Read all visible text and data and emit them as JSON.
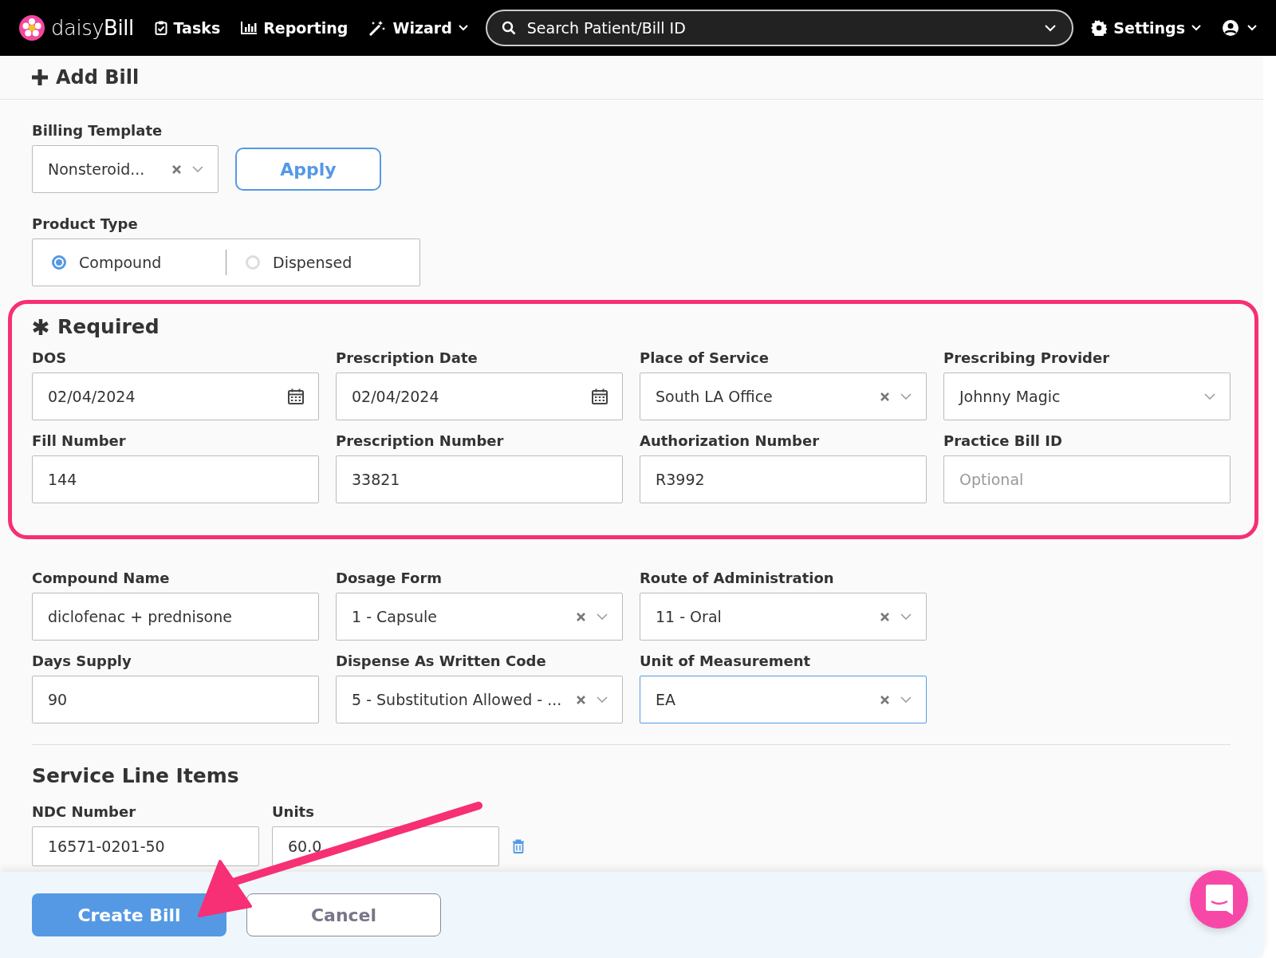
{
  "nav": {
    "logo": "daisy**Bill**",
    "items": [
      {
        "label": "Tasks",
        "dropdown": false
      },
      {
        "label": "Reporting",
        "dropdown": false
      },
      {
        "label": "Wizard",
        "dropdown": true
      }
    ],
    "search": {
      "placeholder": "Search Patient/Bill ID"
    },
    "settings": {
      "label": "Settings"
    }
  },
  "page_title": "Add Bill",
  "billing_template": {
    "label": "Billing Template",
    "value": "Nonsteroid...",
    "apply": "Apply"
  },
  "product_type": {
    "label": "Product Type",
    "options": [
      {
        "label": "Compound",
        "selected": true
      },
      {
        "label": "Dispensed",
        "selected": false
      }
    ]
  },
  "required": {
    "title": "Required",
    "fields": [
      {
        "label": "DOS",
        "kind": "date",
        "value": "02/04/2024",
        "focused": false
      },
      {
        "label": "Prescription Date",
        "kind": "date",
        "value": "02/04/2024",
        "focused": false
      },
      {
        "label": "Place of Service",
        "kind": "select",
        "value": "South LA Office",
        "clearable": true,
        "focused": false
      },
      {
        "label": "Prescribing Provider",
        "kind": "select",
        "value": "Johnny Magic",
        "clearable": false,
        "focused": false
      },
      {
        "label": "Fill Number",
        "kind": "text",
        "value": "144",
        "focused": false
      },
      {
        "label": "Prescription Number",
        "kind": "text",
        "value": "33821",
        "focused": false
      },
      {
        "label": "Authorization Number",
        "kind": "text",
        "value": "R3992",
        "focused": false
      },
      {
        "label": "Practice Bill ID",
        "kind": "text",
        "placeholder": "Optional",
        "focused": false
      }
    ]
  },
  "compound_fields": [
    {
      "label": "Compound Name",
      "kind": "text",
      "value": "diclofenac + prednisone",
      "focused": false
    },
    {
      "label": "Dosage Form",
      "kind": "select",
      "value": "1 - Capsule",
      "clearable": true,
      "focused": false
    },
    {
      "label": "Route of Administration",
      "kind": "select",
      "value": "11 - Oral",
      "clearable": true,
      "focused": false
    },
    {
      "label": "Days Supply",
      "kind": "text",
      "value": "90",
      "focused": false
    },
    {
      "label": "Dispense As Written Code",
      "kind": "select",
      "value": "5 - Substitution Allowed - ...",
      "clearable": true,
      "focused": false
    },
    {
      "label": "Unit of Measurement",
      "kind": "select",
      "value": "EA",
      "clearable": true,
      "focused": true
    }
  ],
  "service_line_items": {
    "title": "Service Line Items",
    "columns": [
      "NDC Number",
      "Units"
    ],
    "rows": [
      {
        "ndc": "16571-0201-50",
        "units": "60.0"
      }
    ]
  },
  "footer_buttons": [
    {
      "label": "Create Bill",
      "kind": "primary"
    },
    {
      "label": "Cancel",
      "kind": "secondary"
    }
  ]
}
